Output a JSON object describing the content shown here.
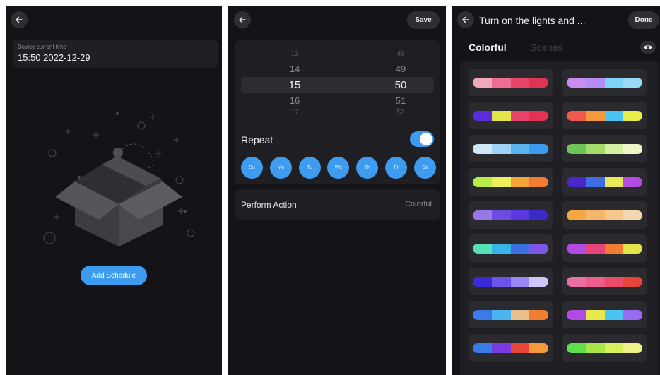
{
  "schedule_screen": {
    "device_time_label": "Device current time",
    "device_time_value": "15:50 2022-12-29",
    "add_schedule_label": "Add Schedule"
  },
  "edit_screen": {
    "save_label": "Save",
    "hour_items": [
      "13",
      "14",
      "15",
      "16",
      "17"
    ],
    "minute_items": [
      "48",
      "49",
      "50",
      "51",
      "52"
    ],
    "selected_hour": "15",
    "selected_minute": "50",
    "repeat_label": "Repeat",
    "repeat_enabled": true,
    "days": [
      "Su",
      "Mo",
      "Tu",
      "We",
      "Th",
      "Fr",
      "Sa"
    ],
    "perform_action_label": "Perform Action",
    "perform_action_value": "Colorful"
  },
  "colorful_screen": {
    "title": "Turn on the lights and ...",
    "done_label": "Done",
    "tabs": [
      {
        "label": "Colorful",
        "active": true
      },
      {
        "label": "Scenes",
        "active": false
      }
    ],
    "palettes": [
      [
        "#f3a7bd",
        "#ec6f93",
        "#e8456d",
        "#e23355"
      ],
      [
        "#c98cf3",
        "#b58cf4",
        "#7fd3f6",
        "#9ad9f6"
      ],
      [
        "#5b2ddc",
        "#e4e34a",
        "#e8456d",
        "#e23355"
      ],
      [
        "#ee5a4f",
        "#f49a3a",
        "#4cc4f0",
        "#e7f04a"
      ],
      [
        "#cfe8f8",
        "#9fd3f5",
        "#5ab3ef",
        "#3d9cf0"
      ],
      [
        "#6ec456",
        "#a5db6b",
        "#d3efa0",
        "#eef7c8"
      ],
      [
        "#b8ec4a",
        "#eef05a",
        "#f4a63a",
        "#f07d32"
      ],
      [
        "#4a27c8",
        "#3f6de6",
        "#e9e95a",
        "#b44be5"
      ],
      [
        "#9a77e8",
        "#6a4de0",
        "#5a3ae0",
        "#3b2ac4"
      ],
      [
        "#f4a840",
        "#f4b66a",
        "#f6c68b",
        "#f1d6b0"
      ],
      [
        "#55e0b6",
        "#3ab4e8",
        "#3b6fe0",
        "#7d55e8"
      ],
      [
        "#b24be6",
        "#e6457a",
        "#f07d32",
        "#e4e34a"
      ],
      [
        "#3a2ad8",
        "#6a55e8",
        "#9a86f0",
        "#cfc6f6"
      ],
      [
        "#ec6fa3",
        "#ee5e8a",
        "#ee4a6a",
        "#e8453a"
      ],
      [
        "#3b7be8",
        "#4cb4f0",
        "#e9be8a",
        "#f07d32"
      ],
      [
        "#b24be6",
        "#e8e84a",
        "#4cc4f0",
        "#9a6af0"
      ],
      [
        "#3b7be8",
        "#7a3ae0",
        "#e8453a",
        "#f49a3a"
      ],
      [
        "#5ee04a",
        "#a8e64a",
        "#d6ef5a",
        "#eef08a"
      ]
    ]
  }
}
